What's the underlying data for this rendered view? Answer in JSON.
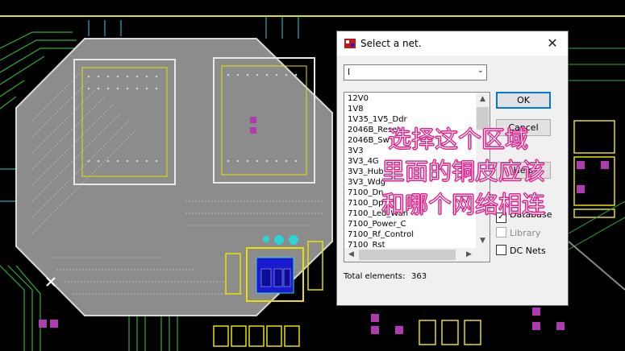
{
  "dialog": {
    "title": "Select a net.",
    "close_glyph": "✕",
    "combo_value": "l",
    "combo_arrow": "⌄",
    "net_list": [
      "12V0",
      "1V8",
      "1V35_1V5_Ddr",
      "2046B_Reset",
      "2046B_Sw",
      "3V3",
      "3V3_4G",
      "3V3_Hub",
      "3V3_Wdg",
      "7100_Dn",
      "7100_Dp",
      "7100_Led_Wan",
      "7100_Power_C",
      "7100_Rf_Control",
      "7100_Rst"
    ],
    "ok_label": "OK",
    "cancel_label": "Cancel",
    "help_label": "Help",
    "database_label": "Database",
    "database_checked": true,
    "library_label": "Library",
    "library_checked": false,
    "dcnets_label": "DC Nets",
    "dcnets_checked": false,
    "total_label": "Total elements:",
    "total_value": "363"
  },
  "annotation": {
    "line1": "选择这个区域",
    "line2": "里面的铜皮应该",
    "line3": "和哪个网络相连",
    "color": "#e0218a"
  },
  "colors": {
    "board_bg": "#000000",
    "copper_pour": "#8c8c8c",
    "trace_green": "#34c234",
    "trace_yellow": "#e8e000",
    "trace_cyan": "#2ed3d6",
    "pad_magenta": "#b03bb0",
    "pad_blue": "#1a1ad0"
  }
}
